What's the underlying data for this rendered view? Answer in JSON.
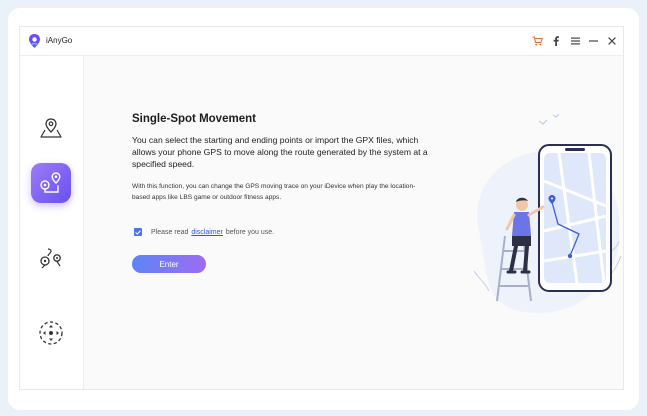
{
  "app": {
    "title": "iAnyGo"
  },
  "titlebar": {
    "buttons": [
      {
        "name": "cart-icon",
        "color": "#f26b2b"
      },
      {
        "name": "facebook-icon"
      },
      {
        "name": "menu-icon"
      },
      {
        "name": "minimize-icon"
      },
      {
        "name": "close-icon"
      }
    ]
  },
  "sidebar": {
    "items": [
      {
        "icon": "change-location-icon",
        "active": false
      },
      {
        "icon": "single-spot-movement-icon",
        "active": true
      },
      {
        "icon": "multi-spot-movement-icon",
        "active": false
      },
      {
        "icon": "joystick-movement-icon",
        "active": false
      }
    ]
  },
  "main": {
    "heading": "Single-Spot Movement",
    "description": "You can select the starting and ending points or import the GPX files, which allows your phone GPS to move along the route generated by the system at a specified speed.",
    "note": "With this function, you can change the GPS moving trace on your iDevice when play the location-based apps like LBS game or outdoor fitness apps.",
    "agree_prefix": "Please read",
    "agree_link": "disclaimer",
    "agree_suffix": "before you use.",
    "checkbox_checked": true,
    "enter_label": "Enter"
  },
  "colors": {
    "accent": "#7b5cf5",
    "button_gradient_start": "#5e85f6",
    "button_gradient_end": "#9c6cf2",
    "link": "#3256d6"
  }
}
